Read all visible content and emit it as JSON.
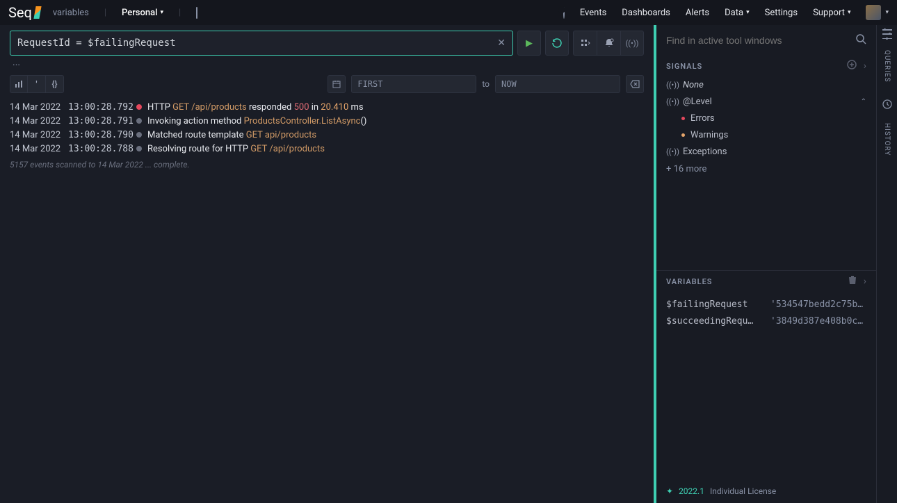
{
  "app": {
    "name": "Seq"
  },
  "breadcrumb": {
    "label": "variables",
    "workspace": "Personal"
  },
  "nav": {
    "events": "Events",
    "dashboards": "Dashboards",
    "alerts": "Alerts",
    "data": "Data",
    "settings": "Settings",
    "support": "Support"
  },
  "query": {
    "text": "RequestId = $failingRequest"
  },
  "timerange": {
    "from": "FIRST",
    "to_label": "to",
    "to": "NOW"
  },
  "events": [
    {
      "date": "14 Mar 2022",
      "time": "13:00:28.792",
      "level": "red",
      "parts": [
        [
          "",
          "HTTP "
        ],
        [
          "hl-method",
          "GET "
        ],
        [
          "hl-path",
          "/api/products"
        ],
        [
          "",
          " responded "
        ],
        [
          "hl-status",
          "500"
        ],
        [
          "",
          " in "
        ],
        [
          "hl-num",
          "20.410"
        ],
        [
          "",
          " ms"
        ]
      ]
    },
    {
      "date": "14 Mar 2022",
      "time": "13:00:28.791",
      "level": "grey",
      "parts": [
        [
          "",
          "Invoking action method "
        ],
        [
          "hl-action",
          "ProductsController.ListAsync"
        ],
        [
          "",
          "()"
        ]
      ]
    },
    {
      "date": "14 Mar 2022",
      "time": "13:00:28.790",
      "level": "grey",
      "parts": [
        [
          "",
          "Matched route template "
        ],
        [
          "hl-method",
          "GET "
        ],
        [
          "hl-path",
          "api/products"
        ]
      ]
    },
    {
      "date": "14 Mar 2022",
      "time": "13:00:28.788",
      "level": "grey",
      "parts": [
        [
          "",
          "Resolving route for HTTP "
        ],
        [
          "hl-method",
          "GET "
        ],
        [
          "hl-path",
          "/api/products"
        ]
      ]
    }
  ],
  "scan_status": "5157 events scanned to 14 Mar 2022 ... complete.",
  "find": {
    "placeholder": "Find in active tool windows"
  },
  "signals": {
    "title": "SIGNALS",
    "none": "None",
    "level": "@Level",
    "errors": "Errors",
    "warnings": "Warnings",
    "exceptions": "Exceptions",
    "more": "+ 16 more"
  },
  "variables": {
    "title": "VARIABLES",
    "rows": [
      {
        "name": "$failingRequest",
        "value": "'534547bedd2c75b…"
      },
      {
        "name": "$succeedingReque…",
        "value": "'3849d387e408b0c…"
      }
    ]
  },
  "tabs": {
    "queries": "QUERIES",
    "history": "HISTORY"
  },
  "footer": {
    "version": "2022.1",
    "license": "Individual License"
  }
}
